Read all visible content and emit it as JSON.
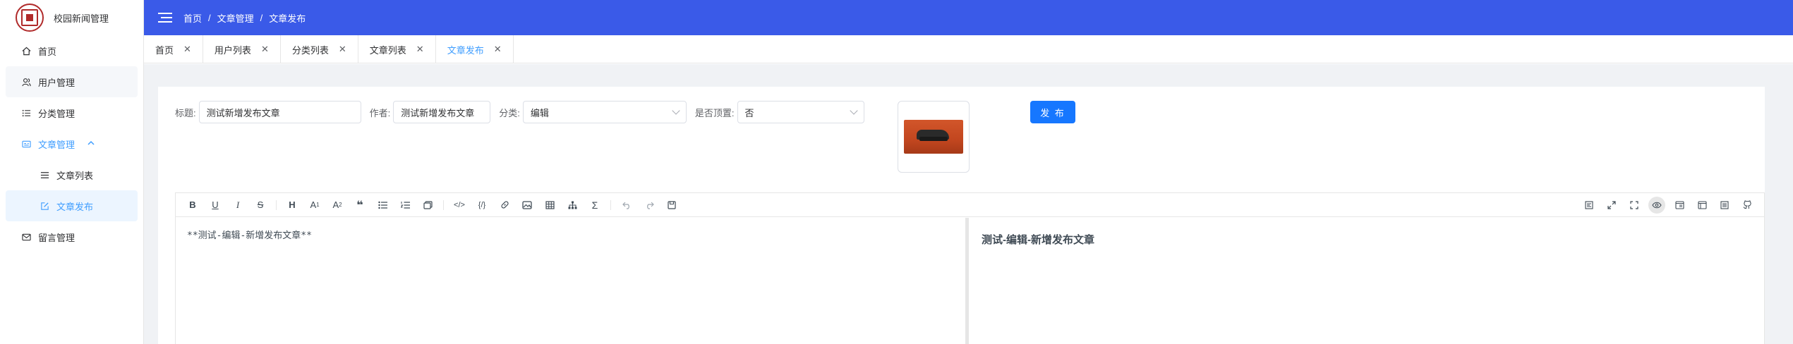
{
  "app": {
    "title": "校园新闻管理"
  },
  "sidebar": {
    "items": [
      {
        "label": "首页",
        "icon": "home-icon"
      },
      {
        "label": "用户管理",
        "icon": "users-icon"
      },
      {
        "label": "分类管理",
        "icon": "list-icon"
      },
      {
        "label": "文章管理",
        "icon": "article-icon",
        "expanded": true,
        "children": [
          {
            "label": "文章列表",
            "icon": "menu-icon"
          },
          {
            "label": "文章发布",
            "icon": "edit-icon",
            "active": true
          }
        ]
      },
      {
        "label": "留言管理",
        "icon": "mail-icon"
      }
    ]
  },
  "header": {
    "breadcrumb": [
      "首页",
      "文章管理",
      "文章发布"
    ],
    "separator": "/"
  },
  "tabs": [
    {
      "label": "首页"
    },
    {
      "label": "用户列表"
    },
    {
      "label": "分类列表"
    },
    {
      "label": "文章列表"
    },
    {
      "label": "文章发布",
      "active": true
    }
  ],
  "form": {
    "title_label": "标题:",
    "title_value": "测试新增发布文章",
    "author_label": "作者:",
    "author_value": "测试新增发布文章",
    "category_label": "分类:",
    "category_value": "编辑",
    "top_label": "是否顶置:",
    "top_value": "否",
    "publish_label": "发 布"
  },
  "editor": {
    "markdown": "**测试-编辑-新增发布文章**",
    "preview": "测试-编辑-新增发布文章"
  },
  "colors": {
    "header_bg": "#3a5ae8",
    "accent": "#409eff",
    "publish_button": "#1677ff"
  }
}
